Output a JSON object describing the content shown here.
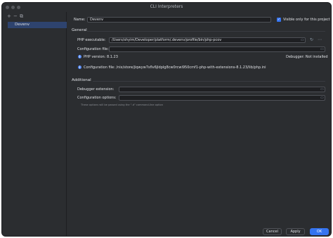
{
  "window": {
    "title": "CLI Interpreters"
  },
  "sidebar": {
    "toolbar": {
      "add": "+",
      "remove": "−",
      "copy": "⧉"
    },
    "items": [
      {
        "label": "Devenv"
      }
    ]
  },
  "form": {
    "name_label": "Name:",
    "name_value": "Devenv",
    "visible_label": "Visible only for this project",
    "visible_checked": true,
    "general_section": "General",
    "php_exec_label": "PHP executable:",
    "php_exec_value": "/Users/shyim/Developer/platform/.devenv/profile/bin/php-pcov",
    "config_file_label": "Configuration file:",
    "config_file_value": "",
    "php_version": "PHP version: 8.1.23",
    "debugger": "Debugger: Not installed",
    "config_file_info": "Configuration file: /nix/store/jiqwyw7sflv6jldplg8cw0rcwi950cmf1-php-with-extensions-8.1.23/lib/php.ini",
    "additional_section": "Additional",
    "debugger_ext_label": "Debugger extension:",
    "debugger_ext_value": "",
    "config_options_label": "Configuration options:",
    "config_options_value": "",
    "config_options_hint": "These options will be passed using the \"-d\" command-line option"
  },
  "footer": {
    "cancel": "Cancel",
    "apply": "Apply",
    "ok": "OK"
  },
  "colors": {
    "accent": "#3574f0",
    "background": "#2b2d30",
    "selection": "#2e436e"
  }
}
